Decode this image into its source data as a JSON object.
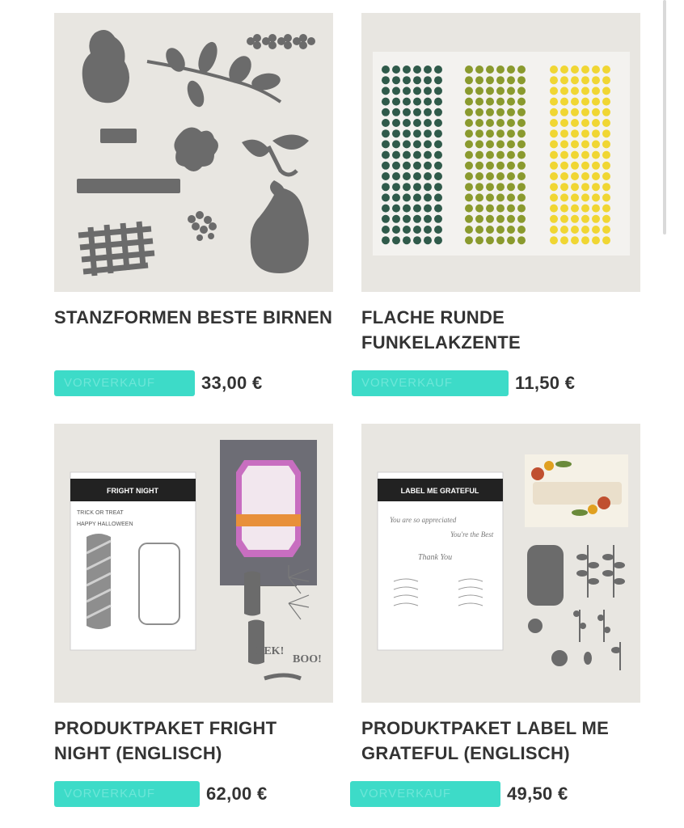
{
  "products": [
    {
      "title": "STANZFORMEN BESTE BIRNEN",
      "badge": "VORVERKAUF",
      "price": "33,00 €"
    },
    {
      "title": "FLACHE RUNDE FUNKELAKZENTE",
      "badge": "VORVERKAUF",
      "price": "11,50 €"
    },
    {
      "title": "PRODUKTPAKET FRIGHT NIGHT (ENGLISCH)",
      "badge": "VORVERKAUF",
      "price": "62,00 €",
      "image_text": {
        "set_name": "FRIGHT NIGHT",
        "tag1": "TRICK OR TREAT",
        "tag2": "HAPPY HALLOWEEN",
        "word1": "EEK!",
        "word2": "BOO!"
      }
    },
    {
      "title": "PRODUKTPAKET LABEL ME GRATEFUL (ENGLISCH)",
      "badge": "VORVERKAUF",
      "price": "49,50 €",
      "image_text": {
        "set_name": "LABEL ME GRATEFUL",
        "s1": "You are so appreciated",
        "s2": "You're the Best",
        "s3": "Thank You"
      }
    }
  ],
  "colors": {
    "badge": "#3ddbc8",
    "text": "#333333",
    "thumb_bg": "#e8e6e1",
    "die_grey": "#6b6b6b",
    "gem_green": "#2f5a4a",
    "gem_olive": "#8a9a2e",
    "gem_yellow": "#f0d633"
  }
}
